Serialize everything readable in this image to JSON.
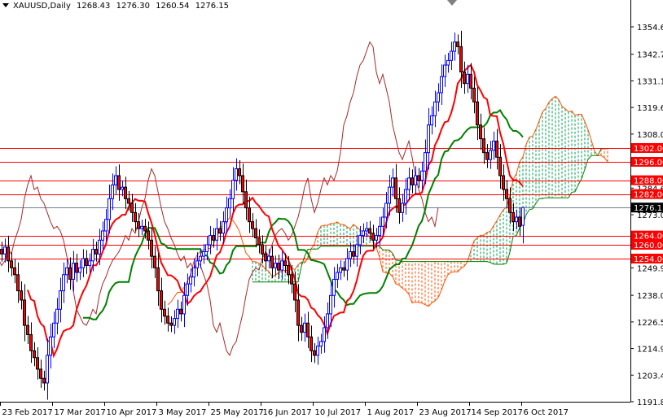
{
  "header": {
    "symbol": "XAUUSD,Daily",
    "open": "1268.43",
    "high": "1276.30",
    "low": "1260.54",
    "close": "1276.15"
  },
  "colors": {
    "bull": "#0000ff",
    "bear": "#ff0000",
    "tenkan": "#ff0000",
    "kijun": "#008000",
    "chikou": "#a52a2a",
    "cloud_up": "#00a050",
    "cloud_down": "#ff5000",
    "level_line": "#ff0000",
    "price_line": "#708090"
  },
  "chart_data": {
    "type": "candlestick",
    "title": "XAUUSD,Daily",
    "indicator": "Ichimoku Kinko Hyo",
    "ylim": [
      1191.85,
      1354.6
    ],
    "y_ticks": [
      "1354.60",
      "1342.70",
      "1331.15",
      "1319.60",
      "1308.05",
      "1284.60",
      "1273.05",
      "1249.95",
      "1238.05",
      "1226.50",
      "1214.95",
      "1203.40",
      "1191.85"
    ],
    "x_ticks": [
      "23 Feb 2017",
      "17 Mar 2017",
      "10 Apr 2017",
      "3 May 2017",
      "25 May 2017",
      "16 Jun 2017",
      "10 Jul 2017",
      "1 Aug 2017",
      "23 Aug 2017",
      "14 Sep 2017",
      "6 Oct 2017"
    ],
    "levels": [
      "1302.00",
      "1296.00",
      "1288.00",
      "1282.00",
      "1264.00",
      "1260.00",
      "1254.00"
    ],
    "current_price": "1276.15",
    "last_bar": {
      "open": 1268.43,
      "high": 1276.3,
      "low": 1260.54,
      "close": 1276.15
    },
    "closes": [
      1256,
      1259,
      1253,
      1250,
      1247,
      1240,
      1236,
      1225,
      1221,
      1214,
      1211,
      1206,
      1202,
      1200,
      1212,
      1220,
      1226,
      1232,
      1240,
      1247,
      1250,
      1245,
      1252,
      1248,
      1250,
      1254,
      1251,
      1253,
      1258,
      1256,
      1262,
      1266,
      1271,
      1280,
      1286,
      1290,
      1284,
      1285,
      1280,
      1278,
      1274,
      1270,
      1267,
      1268,
      1266,
      1262,
      1255,
      1250,
      1240,
      1232,
      1229,
      1226,
      1225,
      1228,
      1232,
      1230,
      1238,
      1243,
      1246,
      1250,
      1253,
      1255,
      1257,
      1260,
      1264,
      1262,
      1267,
      1265,
      1270,
      1276,
      1280,
      1288,
      1293,
      1290,
      1283,
      1276,
      1270,
      1267,
      1263,
      1260,
      1256,
      1253,
      1255,
      1250,
      1252,
      1249,
      1253,
      1251,
      1247,
      1243,
      1236,
      1225,
      1222,
      1226,
      1220,
      1214,
      1212,
      1216,
      1218,
      1224,
      1230,
      1238,
      1245,
      1248,
      1250,
      1249,
      1254,
      1257,
      1255,
      1260,
      1264,
      1266,
      1267,
      1265,
      1262,
      1264,
      1268,
      1272,
      1278,
      1285,
      1289,
      1280,
      1274,
      1278,
      1284,
      1289,
      1286,
      1290,
      1288,
      1292,
      1300,
      1312,
      1316,
      1322,
      1326,
      1333,
      1338,
      1340,
      1344,
      1348,
      1346,
      1335,
      1330,
      1334,
      1328,
      1322,
      1312,
      1306,
      1300,
      1297,
      1301,
      1305,
      1298,
      1290,
      1284,
      1280,
      1274,
      1270,
      1272,
      1268,
      1276.15
    ]
  }
}
